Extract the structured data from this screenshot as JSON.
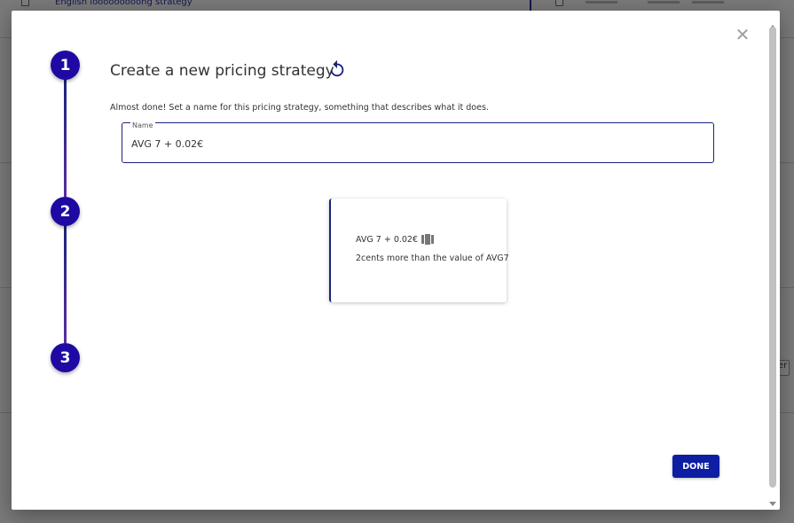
{
  "background": {
    "strategy_text": "English looooooooong strategy",
    "side_button_label": "er"
  },
  "dialog": {
    "title": "Create a new pricing strategy",
    "instructions": "Almost done! Set a name for this pricing strategy, something that describes what it does.",
    "close_icon": "close-icon",
    "reset_icon": "reset-icon",
    "steps": [
      {
        "number": "1"
      },
      {
        "number": "2"
      },
      {
        "number": "3"
      }
    ],
    "name_field": {
      "label": "Name",
      "value": "AVG 7 + 0.02€"
    },
    "preview": {
      "name": "AVG 7 + 0.02€",
      "description": "2cents more than the value of AVG7",
      "icon": "columns-icon"
    },
    "done_label": "DONE",
    "colors": {
      "accent": "#0d1ea3",
      "step": "#1e0aa3"
    }
  }
}
